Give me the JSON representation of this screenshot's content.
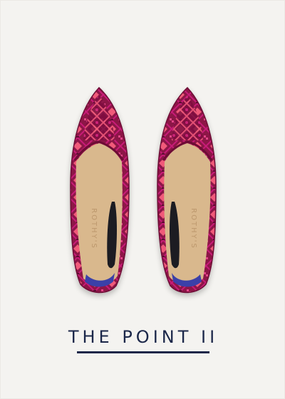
{
  "product": {
    "name": "THE POINT II",
    "insole_brand": "ROTHY'S",
    "image_description_icon": "shoe-pair-icon"
  },
  "colors": {
    "background": "#f4f3f0",
    "shoe_base": "#8d1346",
    "shoe_pattern_pink": "#f05a7a",
    "shoe_pattern_magenta": "#c81c78",
    "insole": "#d9b88d",
    "inner_dark": "#1c1c24",
    "heel_blue": "#3a3fa8",
    "title_color": "#1b2749"
  }
}
